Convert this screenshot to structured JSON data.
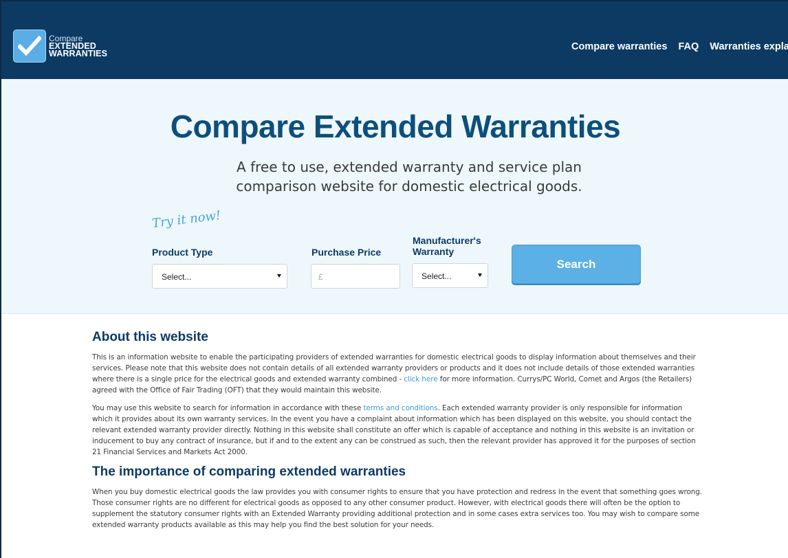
{
  "header": {
    "logo": {
      "line1": "Compare",
      "line2": "EXTENDED",
      "line3": "WARRANTIES"
    },
    "nav": [
      "Compare warranties",
      "FAQ",
      "Warranties explained"
    ]
  },
  "hero": {
    "title": "Compare Extended Warranties",
    "subtitle": "A free to use, extended warranty and service plan comparison website for domestic electrical goods.",
    "try_it": "Try it now!",
    "form": {
      "product_type_label": "Product Type",
      "product_type_value": "Select...",
      "purchase_price_label": "Purchase Price",
      "purchase_price_placeholder": "£",
      "manufacturer_label_1": "Manufacturer's",
      "manufacturer_label_2": "Warranty",
      "manufacturer_value": "Select...",
      "search_label": "Search"
    }
  },
  "about": {
    "heading": "About this website",
    "p1_before": "This is an information website to enable the participating providers of extended warranties for domestic electrical goods to display information about themselves and their services. Please note that this website does not contain details of all extended warranty providers or products and it does not include details of those extended warranties where there is a single price for the electrical goods and extended warranty combined - ",
    "p1_link": "click here",
    "p1_after": " for more information. Currys/PC World, Comet and Argos (the Retailers) agreed with the Office of Fair Trading (OFT) that they would maintain this website.",
    "p2_before": "You may use this website to search for information in accordance with these ",
    "p2_link": "terms and conditions",
    "p2_after": ". Each extended warranty provider is only responsible for information which it provides about its own warranty services. In the event you have a complaint about information which has been displayed on this website, you should contact the relevant extended warranty provider directly. Nothing in this website shall constitute an offer which is capable of acceptance and nothing in this website is an invitation or inducement to buy any contract of insurance, but if and to the extent any can be construed as such, then the relevant provider has approved it for the purposes of section 21 Financial Services and Markets Act 2000."
  },
  "importance": {
    "heading": "The importance of comparing extended warranties",
    "p1": "When you buy domestic electrical goods the law provides you with consumer rights to ensure that you have protection and redress in the event that something goes wrong. Those consumer rights are no different for electrical goods as opposed to any other consumer product. However, with electrical goods there will often be the option to supplement the statutory consumer rights with an Extended Warranty providing additional protection and in some cases extra services too. You may wish to compare some extended warranty products available as this may help you find the best solution for your needs."
  },
  "colors": {
    "header_bg": "#0d3a63",
    "hero_bg": "#eef7fc",
    "title": "#0d4f7c",
    "accent": "#5bb0e6",
    "link": "#3b9bd9"
  }
}
